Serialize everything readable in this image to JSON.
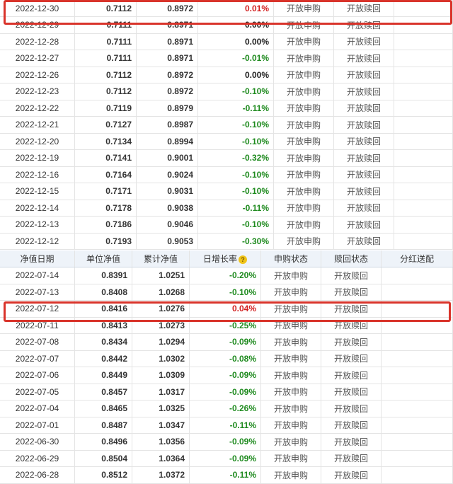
{
  "headers": {
    "date": "净值日期",
    "unit_nav": "单位净值",
    "cum_nav": "累计净值",
    "daily_growth": "日增长率",
    "purchase_status": "申购状态",
    "redeem_status": "赎回状态",
    "dividend": "分红送配",
    "help_icon": "?"
  },
  "block1": [
    {
      "date": "2022-12-30",
      "unit": "0.7112",
      "cum": "0.8972",
      "rate": "0.01%",
      "sign": "pos",
      "buy": "开放申购",
      "redeem": "开放赎回"
    },
    {
      "date": "2022-12-29",
      "unit": "0.7111",
      "cum": "0.8971",
      "rate": "0.00%",
      "sign": "zero",
      "buy": "开放申购",
      "redeem": "开放赎回"
    },
    {
      "date": "2022-12-28",
      "unit": "0.7111",
      "cum": "0.8971",
      "rate": "0.00%",
      "sign": "zero",
      "buy": "开放申购",
      "redeem": "开放赎回"
    },
    {
      "date": "2022-12-27",
      "unit": "0.7111",
      "cum": "0.8971",
      "rate": "-0.01%",
      "sign": "neg",
      "buy": "开放申购",
      "redeem": "开放赎回"
    },
    {
      "date": "2022-12-26",
      "unit": "0.7112",
      "cum": "0.8972",
      "rate": "0.00%",
      "sign": "zero",
      "buy": "开放申购",
      "redeem": "开放赎回"
    },
    {
      "date": "2022-12-23",
      "unit": "0.7112",
      "cum": "0.8972",
      "rate": "-0.10%",
      "sign": "neg",
      "buy": "开放申购",
      "redeem": "开放赎回"
    },
    {
      "date": "2022-12-22",
      "unit": "0.7119",
      "cum": "0.8979",
      "rate": "-0.11%",
      "sign": "neg",
      "buy": "开放申购",
      "redeem": "开放赎回"
    },
    {
      "date": "2022-12-21",
      "unit": "0.7127",
      "cum": "0.8987",
      "rate": "-0.10%",
      "sign": "neg",
      "buy": "开放申购",
      "redeem": "开放赎回"
    },
    {
      "date": "2022-12-20",
      "unit": "0.7134",
      "cum": "0.8994",
      "rate": "-0.10%",
      "sign": "neg",
      "buy": "开放申购",
      "redeem": "开放赎回"
    },
    {
      "date": "2022-12-19",
      "unit": "0.7141",
      "cum": "0.9001",
      "rate": "-0.32%",
      "sign": "neg",
      "buy": "开放申购",
      "redeem": "开放赎回"
    },
    {
      "date": "2022-12-16",
      "unit": "0.7164",
      "cum": "0.9024",
      "rate": "-0.10%",
      "sign": "neg",
      "buy": "开放申购",
      "redeem": "开放赎回"
    },
    {
      "date": "2022-12-15",
      "unit": "0.7171",
      "cum": "0.9031",
      "rate": "-0.10%",
      "sign": "neg",
      "buy": "开放申购",
      "redeem": "开放赎回"
    },
    {
      "date": "2022-12-14",
      "unit": "0.7178",
      "cum": "0.9038",
      "rate": "-0.11%",
      "sign": "neg",
      "buy": "开放申购",
      "redeem": "开放赎回"
    },
    {
      "date": "2022-12-13",
      "unit": "0.7186",
      "cum": "0.9046",
      "rate": "-0.10%",
      "sign": "neg",
      "buy": "开放申购",
      "redeem": "开放赎回"
    },
    {
      "date": "2022-12-12",
      "unit": "0.7193",
      "cum": "0.9053",
      "rate": "-0.30%",
      "sign": "neg",
      "buy": "开放申购",
      "redeem": "开放赎回"
    }
  ],
  "block2": [
    {
      "date": "2022-07-14",
      "unit": "0.8391",
      "cum": "1.0251",
      "rate": "-0.20%",
      "sign": "neg",
      "buy": "开放申购",
      "redeem": "开放赎回"
    },
    {
      "date": "2022-07-13",
      "unit": "0.8408",
      "cum": "1.0268",
      "rate": "-0.10%",
      "sign": "neg",
      "buy": "开放申购",
      "redeem": "开放赎回"
    },
    {
      "date": "2022-07-12",
      "unit": "0.8416",
      "cum": "1.0276",
      "rate": "0.04%",
      "sign": "pos",
      "buy": "开放申购",
      "redeem": "开放赎回"
    },
    {
      "date": "2022-07-11",
      "unit": "0.8413",
      "cum": "1.0273",
      "rate": "-0.25%",
      "sign": "neg",
      "buy": "开放申购",
      "redeem": "开放赎回"
    },
    {
      "date": "2022-07-08",
      "unit": "0.8434",
      "cum": "1.0294",
      "rate": "-0.09%",
      "sign": "neg",
      "buy": "开放申购",
      "redeem": "开放赎回"
    },
    {
      "date": "2022-07-07",
      "unit": "0.8442",
      "cum": "1.0302",
      "rate": "-0.08%",
      "sign": "neg",
      "buy": "开放申购",
      "redeem": "开放赎回"
    },
    {
      "date": "2022-07-06",
      "unit": "0.8449",
      "cum": "1.0309",
      "rate": "-0.09%",
      "sign": "neg",
      "buy": "开放申购",
      "redeem": "开放赎回"
    },
    {
      "date": "2022-07-05",
      "unit": "0.8457",
      "cum": "1.0317",
      "rate": "-0.09%",
      "sign": "neg",
      "buy": "开放申购",
      "redeem": "开放赎回"
    },
    {
      "date": "2022-07-04",
      "unit": "0.8465",
      "cum": "1.0325",
      "rate": "-0.26%",
      "sign": "neg",
      "buy": "开放申购",
      "redeem": "开放赎回"
    },
    {
      "date": "2022-07-01",
      "unit": "0.8487",
      "cum": "1.0347",
      "rate": "-0.11%",
      "sign": "neg",
      "buy": "开放申购",
      "redeem": "开放赎回"
    },
    {
      "date": "2022-06-30",
      "unit": "0.8496",
      "cum": "1.0356",
      "rate": "-0.09%",
      "sign": "neg",
      "buy": "开放申购",
      "redeem": "开放赎回"
    },
    {
      "date": "2022-06-29",
      "unit": "0.8504",
      "cum": "1.0364",
      "rate": "-0.09%",
      "sign": "neg",
      "buy": "开放申购",
      "redeem": "开放赎回"
    },
    {
      "date": "2022-06-28",
      "unit": "0.8512",
      "cum": "1.0372",
      "rate": "-0.11%",
      "sign": "neg",
      "buy": "开放申购",
      "redeem": "开放赎回"
    }
  ],
  "colors": {
    "positive": "#d21f1f",
    "negative": "#1e8a1e",
    "highlight_box": "#d9342b",
    "header_bg": "#eef3f9"
  }
}
